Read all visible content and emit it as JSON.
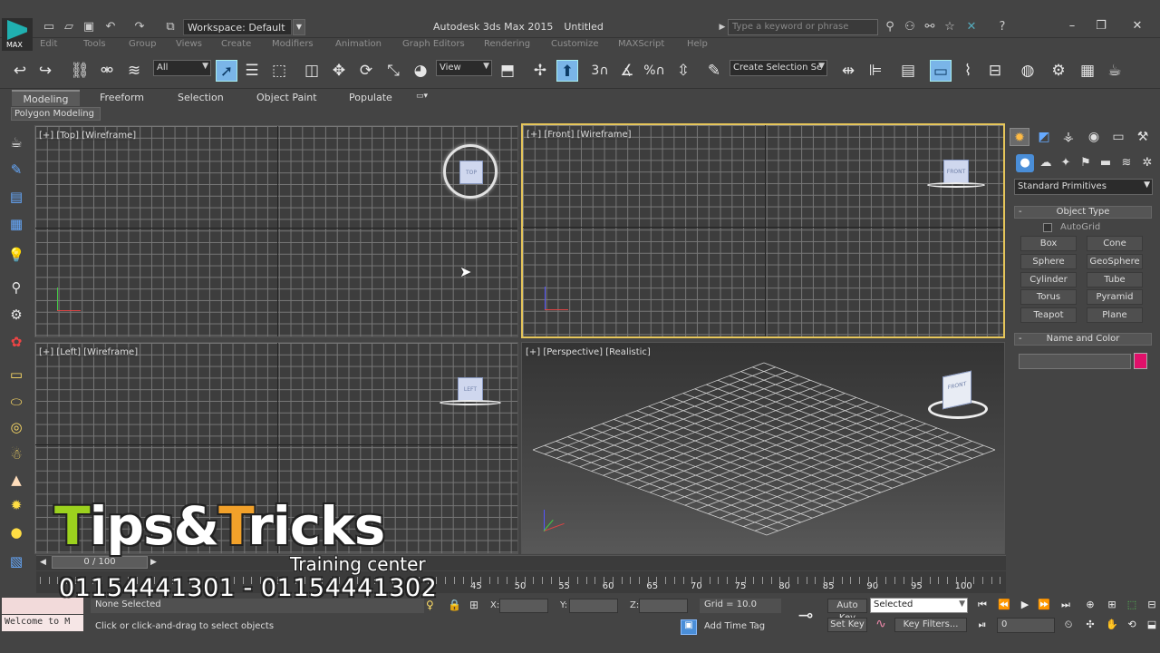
{
  "title_bar": {
    "app_title": "Autodesk 3ds Max 2015",
    "document": "Untitled",
    "workspace_label": "Workspace: Default",
    "search_placeholder": "Type a keyword or phrase",
    "logo_label": "MAX"
  },
  "menu": [
    "Edit",
    "Tools",
    "Group",
    "Views",
    "Create",
    "Modifiers",
    "Animation",
    "Graph Editors",
    "Rendering",
    "Customize",
    "MAXScript",
    "Help"
  ],
  "toolbar": {
    "selection_filter": "All",
    "ref_coord": "View",
    "selection_set_placeholder": "Create Selection Se",
    "snap_count": "3",
    "angle_snap": "%"
  },
  "ribbon": {
    "tabs": [
      "Modeling",
      "Freeform",
      "Selection",
      "Object Paint",
      "Populate"
    ],
    "panel": "Polygon Modeling"
  },
  "viewports": {
    "top": "[+] [Top] [Wireframe]",
    "front": "[+] [Front] [Wireframe]",
    "left": "[+] [Left] [Wireframe]",
    "perspective": "[+] [Perspective] [Realistic]",
    "cube_top": "TOP",
    "cube_front": "FRONT",
    "cube_left": "LEFT",
    "cube_persp": "FRONT"
  },
  "command_panel": {
    "category": "Standard Primitives",
    "object_type_title": "Object Type",
    "autogrid": "AutoGrid",
    "buttons": [
      "Box",
      "Cone",
      "Sphere",
      "GeoSphere",
      "Cylinder",
      "Tube",
      "Torus",
      "Pyramid",
      "Teapot",
      "Plane"
    ],
    "name_color_title": "Name and Color",
    "object_color": "#e0106a"
  },
  "timeline": {
    "slider": "0 / 100",
    "ticks": [
      "45",
      "50",
      "55",
      "60",
      "65",
      "70",
      "75",
      "80",
      "85",
      "90",
      "95",
      "100"
    ]
  },
  "status": {
    "selection": "None Selected",
    "prompt": "Click or click-and-drag to select objects",
    "x_label": "X:",
    "y_label": "Y:",
    "z_label": "Z:",
    "grid": "Grid = 10.0",
    "add_time_tag": "Add Time Tag",
    "auto_key": "Auto Key",
    "set_key": "Set Key",
    "key_filters": "Key Filters...",
    "selected_combo": "Selected",
    "frame": "0",
    "listener": "Welcome to M"
  },
  "watermark": {
    "title_green": "T",
    "title_rest1": "ips",
    "title_amp": "&",
    "title_orange": "T",
    "title_rest2": "ricks",
    "subtitle": "Training center",
    "phones": "01154441301 - 01154441302"
  }
}
